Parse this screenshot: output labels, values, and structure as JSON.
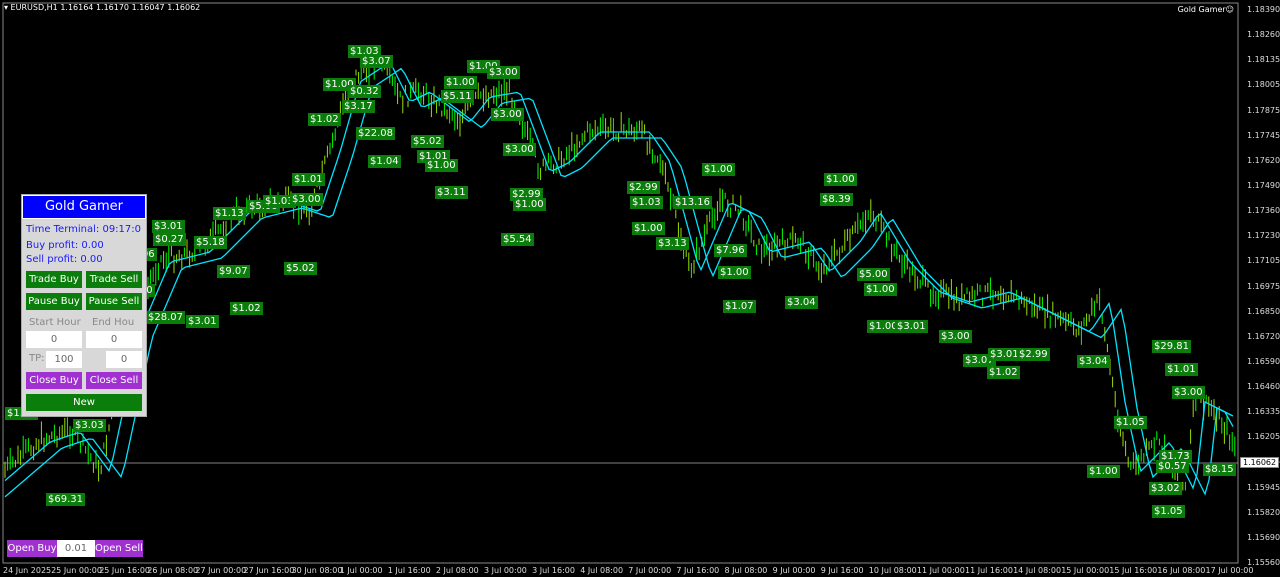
{
  "header": {
    "symbol_info": "▾ EURUSD,H1  1.16164 1.16170 1.16047 1.16062",
    "ea_name": "Gold Gamer☺"
  },
  "colors": {
    "bg": "#000000",
    "candle": "#00ff00",
    "ma": "#00e5ff",
    "label_bg": "#0b7d0b",
    "panel_title": "#0000ff",
    "purple": "#a030d0"
  },
  "panel": {
    "title": "Gold Gamer",
    "time_terminal": "Time Terminal: 09:17:0",
    "buy_profit": "Buy profit: 0.00",
    "sell_profit": "Sell profit: 0.00",
    "trade_buy": "Trade Buy",
    "trade_sell": "Trade Sell",
    "pause_buy": "Pause Buy",
    "pause_sell": "Pause Sell",
    "start_hour_label": "Start Hour",
    "end_hour_label": "End Hou",
    "start_hour": "0",
    "end_hour": "0",
    "tp_label": "TP:",
    "tp": "100",
    "sl": "0",
    "close_buy": "Close Buy",
    "close_sell": "Close Sell",
    "new": "New"
  },
  "bottom": {
    "open_buy": "Open Buy",
    "lot": "0.01",
    "open_sell": "Open Sell"
  },
  "price_axis": [
    "1.18390",
    "1.18260",
    "1.18135",
    "1.18005",
    "1.17875",
    "1.17745",
    "1.17620",
    "1.17490",
    "1.17360",
    "1.17230",
    "1.17105",
    "1.16975",
    "1.16850",
    "1.16720",
    "1.16590",
    "1.16460",
    "1.16335",
    "1.16205",
    "1.16075",
    "1.15945",
    "1.15820",
    "1.15690",
    "1.15560"
  ],
  "current_price": "1.16062",
  "time_axis": [
    "24 Jun 2025",
    "25 Jun 00:00",
    "25 Jun 16:00",
    "26 Jun 08:00",
    "27 Jun 00:00",
    "27 Jun 16:00",
    "30 Jun 08:00",
    "1 Jul 00:00",
    "1 Jul 16:00",
    "2 Jul 08:00",
    "3 Jul 00:00",
    "3 Jul 16:00",
    "4 Jul 08:00",
    "7 Jul 00:00",
    "7 Jul 16:00",
    "8 Jul 08:00",
    "9 Jul 00:00",
    "9 Jul 16:00",
    "10 Jul 08:00",
    "11 Jul 00:00",
    "11 Jul 16:00",
    "14 Jul 08:00",
    "15 Jul 00:00",
    "15 Jul 16:00",
    "16 Jul 08:00",
    "17 Jul 00:00"
  ],
  "trade_labels": [
    "$1.03",
    "$3.07",
    "$1.00",
    "$0.32",
    "$3.17",
    "$1.02",
    "$22.08",
    "$1.04",
    "$1.00",
    "$5.11",
    "$1.00",
    "$3.00",
    "$3.00",
    "$5.02",
    "$1.01",
    "$1.00",
    "$3.11",
    "$3.00",
    "$2.99",
    "$1.00",
    "$5.54",
    "$1.01",
    "$1.13",
    "$5.00",
    "$1.03",
    "$3.00",
    "$1.06",
    "$3.01",
    "$0.27",
    "$5.18",
    "$9.07",
    "$5.02",
    "$1.02",
    "$3.01",
    "$28.07",
    "$3.00",
    "$1.09",
    "$3.03",
    "$69.31",
    "$1.03",
    "$1.00",
    "$1.00",
    "$2.99",
    "$1.03",
    "$13.16",
    "$1.00",
    "$3.13",
    "$1.00",
    "$7.96",
    "$1.00",
    "$1.07",
    "$1.00",
    "$8.39",
    "$3.04",
    "$5.00",
    "$1.00",
    "$1.00",
    "$3.01",
    "$3.00",
    "$3.07",
    "$3.01",
    "$1.02",
    "$2.99",
    "$3.04",
    "$29.81",
    "$1.01",
    "$3.00",
    "$1.05",
    "$1.73",
    "$0.57",
    "$1.00",
    "$3.02",
    "$8.15",
    "$1.05"
  ]
}
